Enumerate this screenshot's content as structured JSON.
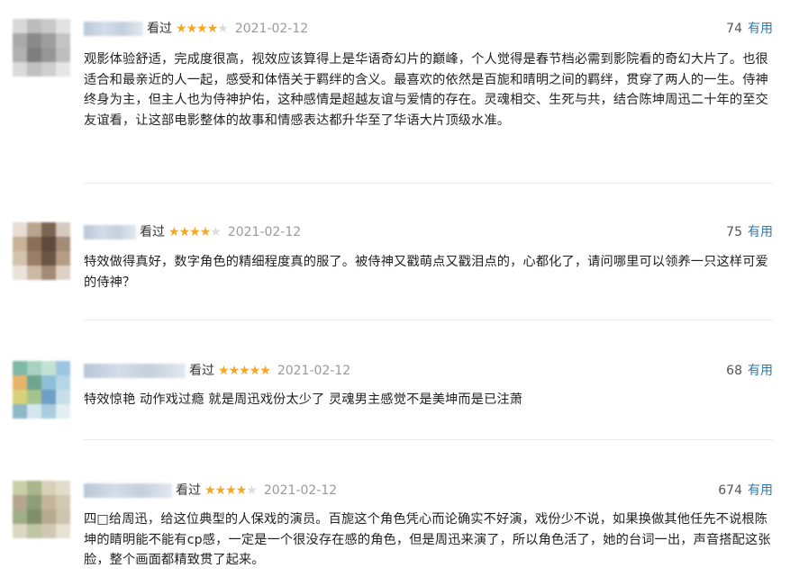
{
  "reviews": [
    {
      "status": "看过",
      "rating": 4,
      "date": "2021-02-12",
      "votes": "74",
      "useful_label": "有用",
      "content": "观影体验舒适，完成度很高，视效应该算得上是华语奇幻片的巅峰，个人觉得是春节档必需到影院看的奇幻大片了。也很适合和最亲近的人一起，感受和体悟关于羁绊的含义。最喜欢的依然是百旎和晴明之间的羁绊，贯穿了两人的一生。侍神终身为主，但主人也为侍神护佑，这种感情是超越友谊与爱情的存在。灵魂相交、生死与共，结合陈坤周迅二十年的至交友谊看，让这部电影整体的故事和情感表达都升华至了华语大片顶级水准。"
    },
    {
      "status": "看过",
      "rating": 4,
      "date": "2021-02-12",
      "votes": "75",
      "useful_label": "有用",
      "content": "特效做得真好，数字角色的精细程度真的服了。被侍神又戳萌点又戳泪点的，心都化了，请问哪里可以领养一只这样可爱的侍神？"
    },
    {
      "status": "看过",
      "rating": 5,
      "date": "2021-02-12",
      "votes": "68",
      "useful_label": "有用",
      "content": "特效惊艳 动作戏过瘾 就是周迅戏份太少了 灵魂男主感觉不是美坤而是已注萧"
    },
    {
      "status": "看过",
      "rating": 4,
      "date": "2021-02-12",
      "votes": "674",
      "useful_label": "有用",
      "content": "四□给周迅，给这位典型的人保戏的演员。百旎这个角色凭心而论确实不好演，戏份少不说，如果换做其他任先不说根陈坤的睛明能不能有cp感，一定是一个很没存在感的角色，但是周迅来演了，所以角色活了，她的台词一出，声音搭配这张脸，整个画面都精致贯了起来。"
    }
  ],
  "colors": {
    "star": "#f5a623",
    "star_empty": "#dcdcdc",
    "useful_link": "#3377aa",
    "date": "#9a9a9a"
  },
  "icons": {
    "avatar": "blurred-avatar",
    "username": "blurred-username",
    "star": "star-icon"
  }
}
